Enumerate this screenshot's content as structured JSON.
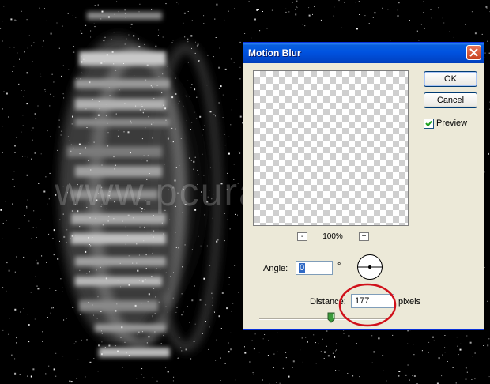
{
  "watermark": "www.pcuramlar.com",
  "dialog": {
    "title": "Motion Blur",
    "ok_label": "OK",
    "cancel_label": "Cancel",
    "preview_label": "Preview",
    "preview_checked": true,
    "zoom_out_label": "-",
    "zoom_in_label": "+",
    "zoom_level": "100%",
    "angle_label": "Angle:",
    "angle_value": "0",
    "angle_unit": "°",
    "distance_label": "Distance:",
    "distance_value": "177",
    "distance_unit": "pixels",
    "slider_level_fraction": 0.57
  },
  "colors": {
    "titlebar": "#0054e3",
    "dialog_bg": "#ece9d8",
    "highlight_circle": "#d0101a",
    "canvas_bg": "#000000"
  },
  "icons": {
    "close": "close-icon",
    "check": "check-icon",
    "angle_dial": "angle-dial-icon",
    "slider_thumb": "slider-thumb-icon"
  }
}
